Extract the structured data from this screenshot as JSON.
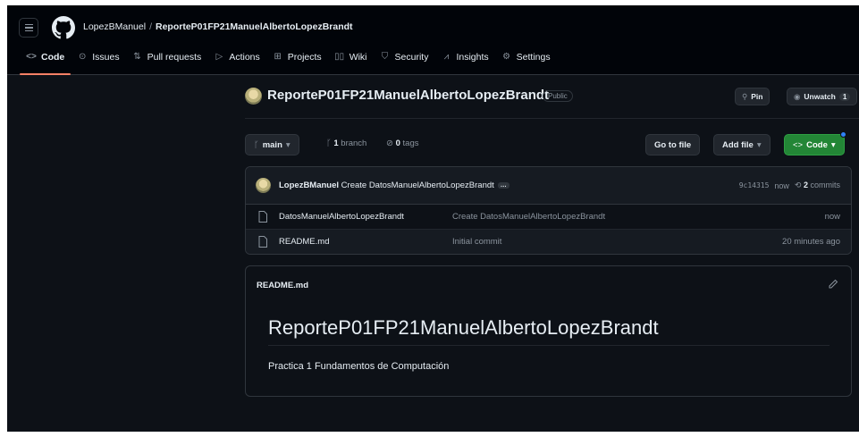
{
  "header": {
    "owner": "LopezBManuel",
    "separator": "/",
    "repo": "ReporteP01FP21ManuelAlbertoLopezBrandt"
  },
  "tabs": [
    {
      "label": "Code",
      "icon": "code-icon",
      "glyph": "<>"
    },
    {
      "label": "Issues",
      "icon": "issue-icon",
      "glyph": "⊙"
    },
    {
      "label": "Pull requests",
      "icon": "pull-request-icon",
      "glyph": "⇅"
    },
    {
      "label": "Actions",
      "icon": "play-icon",
      "glyph": "▷"
    },
    {
      "label": "Projects",
      "icon": "table-icon",
      "glyph": "⊞"
    },
    {
      "label": "Wiki",
      "icon": "book-icon",
      "glyph": "▯▯"
    },
    {
      "label": "Security",
      "icon": "shield-icon",
      "glyph": "⛉"
    },
    {
      "label": "Insights",
      "icon": "graph-icon",
      "glyph": "⩘"
    },
    {
      "label": "Settings",
      "icon": "gear-icon",
      "glyph": "⚙"
    }
  ],
  "repo_head": {
    "name": "ReporteP01FP21ManuelAlbertoLopezBrandt",
    "visibility": "Public",
    "pin_label": "Pin",
    "unwatch_label": "Unwatch",
    "watch_count": "1"
  },
  "toolbar": {
    "branch": "main",
    "branch_count": "1",
    "branch_word": "branch",
    "tag_count": "0",
    "tag_word": "tags",
    "go_to_file": "Go to file",
    "add_file": "Add file",
    "code_button": "Code"
  },
  "commit": {
    "author": "LopezBManuel",
    "message": "Create DatosManuelAlbertoLopezBrandt",
    "ellipsis": "…",
    "hash": "9c14315",
    "time": "now",
    "commit_count": "2",
    "commit_word": "commits"
  },
  "files": [
    {
      "name": "DatosManuelAlbertoLopezBrandt",
      "message": "Create DatosManuelAlbertoLopezBrandt",
      "time": "now"
    },
    {
      "name": "README.md",
      "message": "Initial commit",
      "time": "20 minutes ago"
    }
  ],
  "readme": {
    "filename": "README.md",
    "title": "ReporteP01FP21ManuelAlbertoLopezBrandt",
    "body": "Practica 1 Fundamentos de Computación"
  },
  "colors": {
    "background": "#0d1117",
    "header": "#010409",
    "accent_tab": "#f78166",
    "green_button": "#238636",
    "muted_text": "#8b949e"
  }
}
